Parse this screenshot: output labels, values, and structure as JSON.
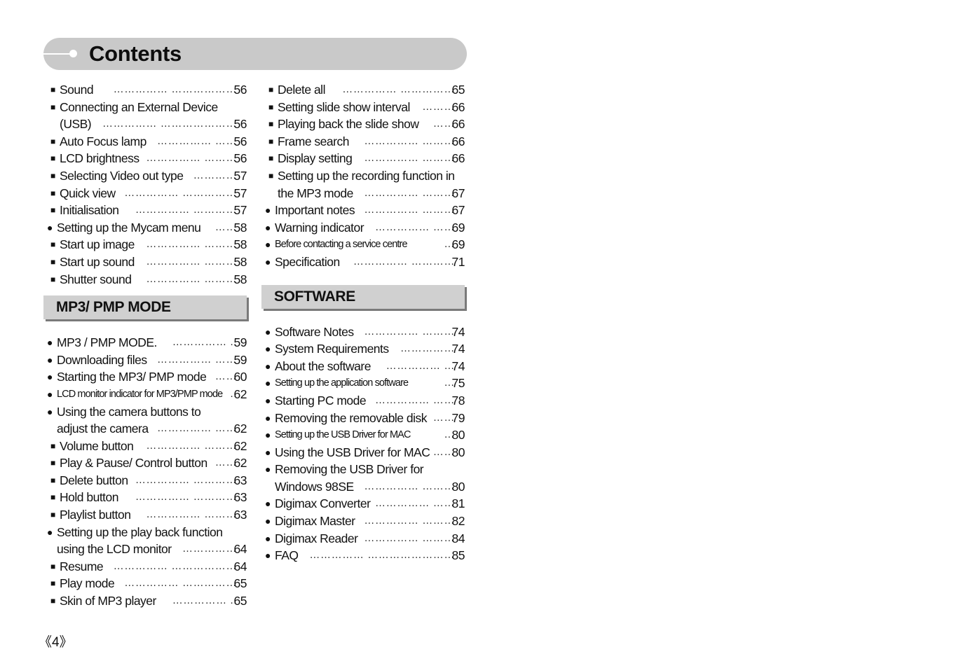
{
  "title": "Contents",
  "page_number": "《4》",
  "left_column": {
    "top_entries": [
      {
        "bullet": "square",
        "label": "Sound",
        "leader": "…………… ………………",
        "page": "56"
      },
      {
        "bullet": "square",
        "label": "Connecting an External Device",
        "leader": "",
        "page": ""
      },
      {
        "bullet": "none",
        "label": "(USB)",
        "leader": "…………… …………………",
        "page": "56"
      },
      {
        "bullet": "square",
        "label": "Auto Focus lamp",
        "leader": "…………… ……",
        "page": "56"
      },
      {
        "bullet": "square",
        "label": "LCD brightness",
        "leader": "…………… ………",
        "page": "56"
      },
      {
        "bullet": "square",
        "label": "Selecting Video out type",
        "leader": "…………",
        "page": "57"
      },
      {
        "bullet": "square",
        "label": "Quick view",
        "leader": "…………… ……………",
        "page": "57"
      },
      {
        "bullet": "square",
        "label": "Initialisation",
        "leader": "…………… …………",
        "page": "57"
      },
      {
        "bullet": "circle",
        "label": "Setting up the Mycam menu",
        "leader": "……",
        "page": "58"
      },
      {
        "bullet": "square",
        "label": "Start up image",
        "leader": "…………… ………",
        "page": "58"
      },
      {
        "bullet": "square",
        "label": "Start up sound",
        "leader": "…………… ………",
        "page": "58"
      },
      {
        "bullet": "square",
        "label": "Shutter sound",
        "leader": "…………… ………",
        "page": "58"
      }
    ],
    "section_title": "MP3/ PMP MODE",
    "section_entries": [
      {
        "bullet": "circle",
        "label": "MP3 / PMP MODE.",
        "leader": "…………… ..",
        "page": "59"
      },
      {
        "bullet": "circle",
        "label": "Downloading files",
        "leader": "…………… ……",
        "page": "59"
      },
      {
        "bullet": "circle",
        "label": "Starting the MP3/ PMP mode",
        "leader": "……",
        "page": "60"
      },
      {
        "bullet": "circle",
        "label": "LCD monitor indicator for MP3/PMP mode",
        "leader": "..",
        "page": "62",
        "small": true
      },
      {
        "bullet": "circle",
        "label": "Using the camera buttons to",
        "leader": "",
        "page": ""
      },
      {
        "bullet": "none-circle",
        "label": "adjust the camera",
        "leader": "…………… ……",
        "page": "62"
      },
      {
        "bullet": "square",
        "label": "Volume button",
        "leader": "…………… ………",
        "page": "62"
      },
      {
        "bullet": "square",
        "label": "Play & Pause/ Control button",
        "leader": "……",
        "page": "62"
      },
      {
        "bullet": "square",
        "label": "Delete button",
        "leader": "…………… …………",
        "page": "63"
      },
      {
        "bullet": "square",
        "label": "Hold button",
        "leader": "…………… …………",
        "page": "63"
      },
      {
        "bullet": "square",
        "label": "Playlist button",
        "leader": "…………… ………",
        "page": "63"
      },
      {
        "bullet": "circle",
        "label": "Setting up the play back function",
        "leader": "",
        "page": ""
      },
      {
        "bullet": "none-circle",
        "label": "using the LCD monitor",
        "leader": "……………",
        "page": "64"
      },
      {
        "bullet": "square",
        "label": "Resume",
        "leader": "…………… ………………",
        "page": "64"
      },
      {
        "bullet": "square",
        "label": "Play mode",
        "leader": "…………… ……………",
        "page": "65"
      },
      {
        "bullet": "square",
        "label": "Skin of MP3 player",
        "leader": "…………… ..",
        "page": "65"
      }
    ]
  },
  "right_column": {
    "top_entries": [
      {
        "bullet": "square",
        "label": "Delete all",
        "leader": "…………… ……………",
        "page": "65"
      },
      {
        "bullet": "square",
        "label": "Setting slide show interval",
        "leader": "………",
        "page": "66"
      },
      {
        "bullet": "square",
        "label": "Playing back the slide show",
        "leader": "……",
        "page": "66"
      },
      {
        "bullet": "square",
        "label": "Frame search",
        "leader": "…………… ………",
        "page": "66"
      },
      {
        "bullet": "square",
        "label": "Display setting",
        "leader": "…………… ………",
        "page": "66"
      },
      {
        "bullet": "square",
        "label": "Setting up the recording function in",
        "leader": "",
        "page": ""
      },
      {
        "bullet": "none",
        "label": "the MP3 mode",
        "leader": "…………… ………",
        "page": "67"
      },
      {
        "bullet": "circle",
        "label": "Important notes",
        "leader": "…………… ………",
        "page": "67"
      },
      {
        "bullet": "circle",
        "label": "Warning indicator",
        "leader": "…………… ……",
        "page": "69"
      },
      {
        "bullet": "circle",
        "label": "Before contacting a service centre",
        "leader": "…",
        "page": "69",
        "small": true
      },
      {
        "bullet": "circle",
        "label": "Specification",
        "leader": "…………… …………",
        "page": "71"
      }
    ],
    "section_title": "SOFTWARE",
    "section_entries": [
      {
        "bullet": "circle",
        "label": "Software Notes",
        "leader": "…………… ………",
        "page": "74"
      },
      {
        "bullet": "circle",
        "label": "System Requirements",
        "leader": "……………",
        "page": "74"
      },
      {
        "bullet": "circle",
        "label": "About the software",
        "leader": "…………… …",
        "page": "74"
      },
      {
        "bullet": "circle",
        "label": "Setting up the application software",
        "leader": "…",
        "page": "75",
        "small": true
      },
      {
        "bullet": "circle",
        "label": "Starting PC mode",
        "leader": "…………… ……",
        "page": "78"
      },
      {
        "bullet": "circle",
        "label": "Removing the removable disk",
        "leader": "……",
        "page": "79"
      },
      {
        "bullet": "circle",
        "label": "Setting up the USB Driver for MAC",
        "leader": "…",
        "page": "80",
        "small": true
      },
      {
        "bullet": "circle",
        "label": "Using the USB Driver for MAC",
        "leader": "……",
        "page": "80"
      },
      {
        "bullet": "circle",
        "label": "Removing the USB Driver for",
        "leader": "",
        "page": ""
      },
      {
        "bullet": "none-circle",
        "label": "Windows 98SE",
        "leader": "…………… ………",
        "page": "80"
      },
      {
        "bullet": "circle",
        "label": "Digimax Converter",
        "leader": "…………… ……",
        "page": "81"
      },
      {
        "bullet": "circle",
        "label": "Digimax Master",
        "leader": "…………… ………",
        "page": "82"
      },
      {
        "bullet": "circle",
        "label": "Digimax Reader",
        "leader": "…………… ………",
        "page": "84"
      },
      {
        "bullet": "circle",
        "label": "FAQ",
        "leader": "…………… ……………………",
        "page": "85"
      }
    ]
  }
}
